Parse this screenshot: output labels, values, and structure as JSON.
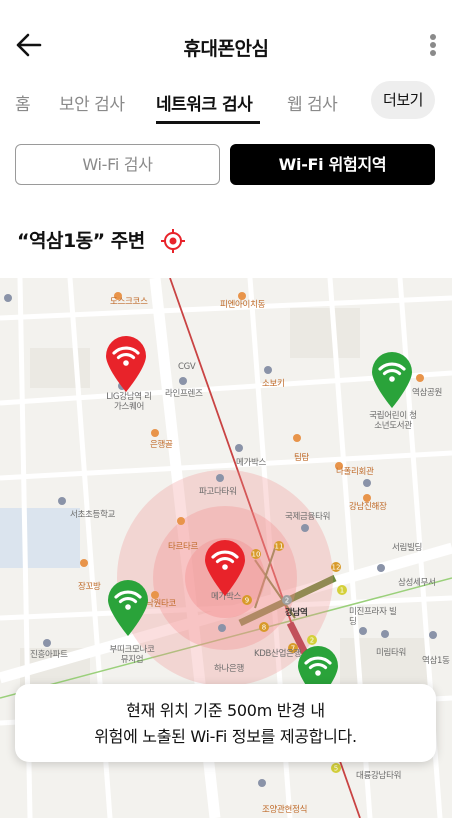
{
  "header": {
    "title": "휴대폰안심"
  },
  "tabs": [
    {
      "label": "홈"
    },
    {
      "label": "보안 검사"
    },
    {
      "label": "네트워크 검사"
    },
    {
      "label": "웹 검사"
    }
  ],
  "more_tab": "더보기",
  "segments": {
    "wifi_check": "Wi-Fi 검사",
    "wifi_risk_area": "Wi-Fi 위험지역"
  },
  "location": {
    "label": "“역삼1동” 주변"
  },
  "map": {
    "colors": {
      "risk": "#e8232a",
      "safe": "#2aa33a",
      "radius": "#f28b8b"
    },
    "pois": [
      "도스크코스",
      "피엔아이치동",
      "CGV",
      "라인프렌즈",
      "소보키",
      "LIG강남역 리가스퀘어",
      "은행골",
      "메가박스",
      "팀탐",
      "국립어린이 청소년도서관",
      "역삼공원",
      "파고다타워",
      "나폴리회관",
      "서초초등학교",
      "강남진해장",
      "타르타르",
      "메가박스",
      "국제금융타워",
      "서림빌딩",
      "강남역",
      "삼성세무서",
      "장꼬방",
      "낙원타코",
      "미진프라자 빌딩",
      "부띠크모나코 뮤지엄",
      "진흥아파트",
      "KDB산업은행",
      "하나은행",
      "미림타워",
      "역삼1동",
      "대륭강남타워",
      "조양관현정식"
    ]
  },
  "info": {
    "line1": "현재 위치 기준 500m 반경 내",
    "line2": "위험에 노출된 Wi-Fi 정보를 제공합니다."
  }
}
